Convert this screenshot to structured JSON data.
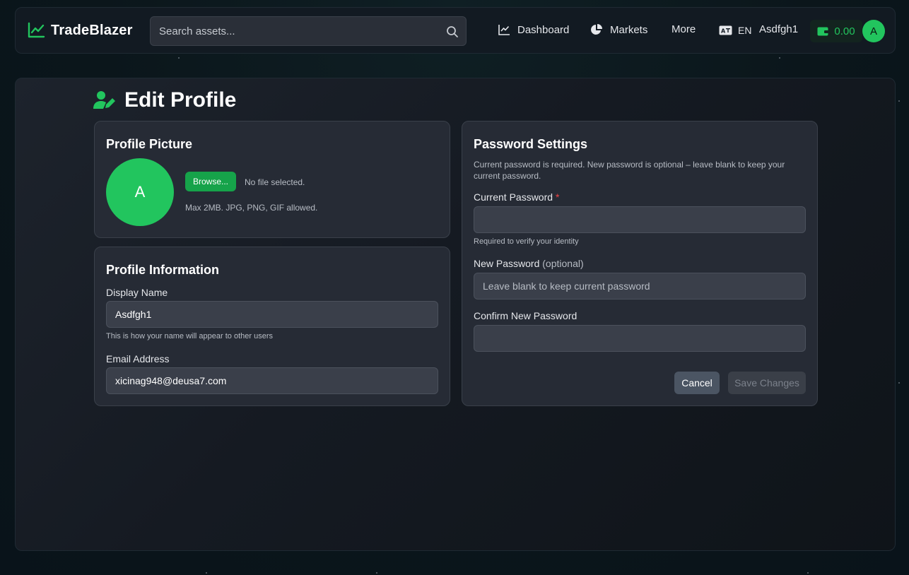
{
  "app": {
    "name": "TradeBlazer"
  },
  "search": {
    "placeholder": "Search assets..."
  },
  "nav": {
    "dashboard": "Dashboard",
    "markets": "Markets",
    "more": "More",
    "language": "EN",
    "username": "Asdfgh1",
    "wallet_balance": "0.00",
    "avatar_initial": "A"
  },
  "page": {
    "title": "Edit Profile"
  },
  "profile_picture": {
    "heading": "Profile Picture",
    "avatar_initial": "A",
    "browse_label": "Browse...",
    "file_status": "No file selected.",
    "hint": "Max 2MB. JPG, PNG, GIF allowed."
  },
  "profile_info": {
    "heading": "Profile Information",
    "display_name_label": "Display Name",
    "display_name_value": "Asdfgh1",
    "display_name_help": "This is how your name will appear to other users",
    "email_label": "Email Address",
    "email_value": "xicinag948@deusa7.com"
  },
  "password": {
    "heading": "Password Settings",
    "description": "Current password is required. New password is optional – leave blank to keep your current password.",
    "current_label": "Current Password",
    "required_marker": "*",
    "current_help": "Required to verify your identity",
    "new_label": "New Password",
    "new_optional": "(optional)",
    "new_placeholder": "Leave blank to keep current password",
    "confirm_label": "Confirm New Password",
    "cancel_label": "Cancel",
    "save_label": "Save Changes"
  },
  "colors": {
    "accent": "#22c55e",
    "accent_dark": "#16a34a",
    "background": "#0b161b",
    "card": "#262b35",
    "required": "#ef4444"
  },
  "icons": {
    "brand": "chart-line-icon",
    "search": "search-icon",
    "dashboard": "chart-line-icon",
    "markets": "pie-chart-icon",
    "language": "language-icon",
    "wallet": "wallet-icon",
    "title": "user-edit-icon"
  }
}
